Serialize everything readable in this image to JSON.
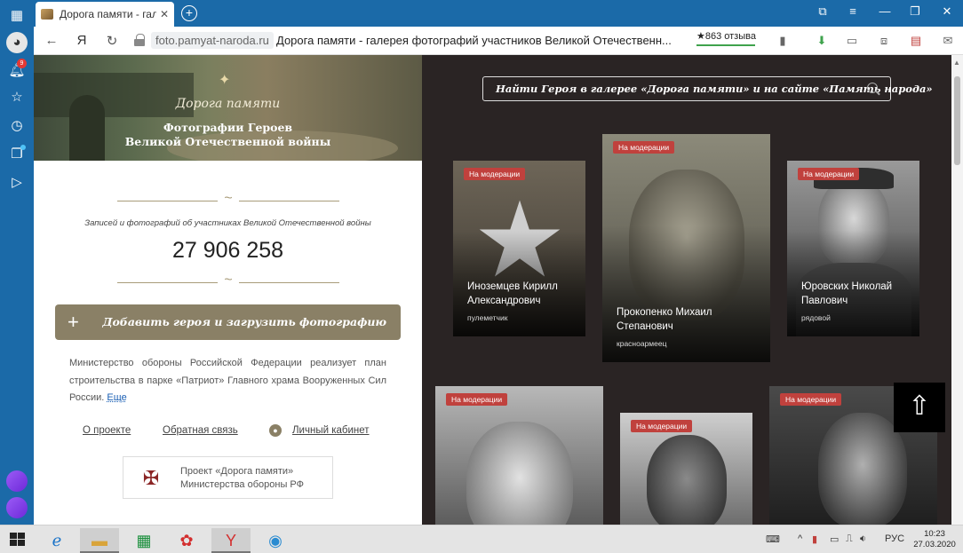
{
  "browser": {
    "tab_title": "Дорога памяти - галерея",
    "tab_close": "✕",
    "new_tab": "+",
    "domain": "foto.pamyat-naroda.ru",
    "page_title": "Дорога памяти - галерея фотографий участников Великой Отечественн...",
    "reviews": "★863 отзыва",
    "back_glyph": "←",
    "ya_glyph": "Я",
    "reload_glyph": "↻",
    "sidebar_badge": "9"
  },
  "hero": {
    "brand": "Дорога памяти",
    "subtitle_line1": "Фотографии Героев",
    "subtitle_line2": "Великой Отечественной войны"
  },
  "stats": {
    "caption": "Записей и фотографий об участниках Великой Отечественной войны",
    "count": "27 906 258"
  },
  "add_button": {
    "plus": "+",
    "label": "Добавить героя и загрузить фотографию"
  },
  "description": {
    "text": "Министерство обороны Российской Федерации реализует план строительства в парке «Патриот» Главного храма Вооруженных Сил России.",
    "more": "Еще"
  },
  "links": {
    "about": "О проекте",
    "feedback": "Обратная связь",
    "cabinet": "Личный кабинет"
  },
  "project_box": {
    "line1": "Проект «Дорога памяти»",
    "line2": "Министерства обороны РФ"
  },
  "search": {
    "placeholder": "Найти Героя в галерее «Дорога памяти» и на сайте «Память народа»"
  },
  "gallery": {
    "moderation_label": "На модерации",
    "cards": [
      {
        "name1": "Иноземцев Кирилл",
        "name2": "Александрович",
        "rank": "пулеметчик"
      },
      {
        "name1": "Прокопенко Михаил",
        "name2": "Степанович",
        "rank": "красноармеец"
      },
      {
        "name1": "Юровских Николай",
        "name2": "Павлович",
        "rank": "рядовой"
      }
    ]
  },
  "taskbar": {
    "lang": "РУС",
    "time": "10:23",
    "date": "27.03.2020"
  },
  "colors": {
    "sidebar": "#1b6aa8",
    "gallery_bg": "#2a2424",
    "button": "#8a8066",
    "tag": "#c0413d"
  }
}
